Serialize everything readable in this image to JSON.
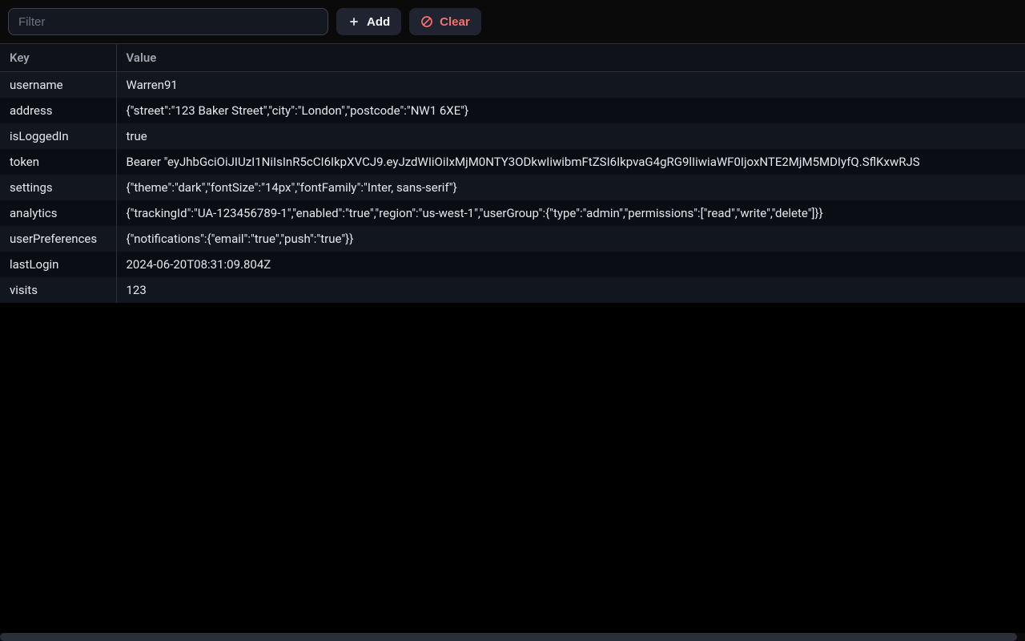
{
  "toolbar": {
    "filter_placeholder": "Filter",
    "add_label": "Add",
    "clear_label": "Clear"
  },
  "table": {
    "headers": {
      "key": "Key",
      "value": "Value"
    },
    "rows": [
      {
        "key": "username",
        "value": "Warren91"
      },
      {
        "key": "address",
        "value": "{\"street\":\"123 Baker Street\",\"city\":\"London\",\"postcode\":\"NW1 6XE\"}"
      },
      {
        "key": "isLoggedIn",
        "value": "true"
      },
      {
        "key": "token",
        "value": "Bearer \"eyJhbGciOiJIUzI1NiIsInR5cCI6IkpXVCJ9.eyJzdWIiOiIxMjM0NTY3ODkwIiwibmFtZSI6IkpvaG4gRG9lIiwiaWF0IjoxNTE2MjM5MDIyfQ.SflKxwRJS"
      },
      {
        "key": "settings",
        "value": "{\"theme\":\"dark\",\"fontSize\":\"14px\",\"fontFamily\":\"Inter, sans-serif\"}"
      },
      {
        "key": "analytics",
        "value": "{\"trackingId\":\"UA-123456789-1\",\"enabled\":\"true\",\"region\":\"us-west-1\",\"userGroup\":{\"type\":\"admin\",\"permissions\":[\"read\",\"write\",\"delete\"]}}"
      },
      {
        "key": "userPreferences",
        "value": "{\"notifications\":{\"email\":\"true\",\"push\":\"true\"}}"
      },
      {
        "key": "lastLogin",
        "value": "2024-06-20T08:31:09.804Z"
      },
      {
        "key": "visits",
        "value": "123"
      }
    ]
  }
}
